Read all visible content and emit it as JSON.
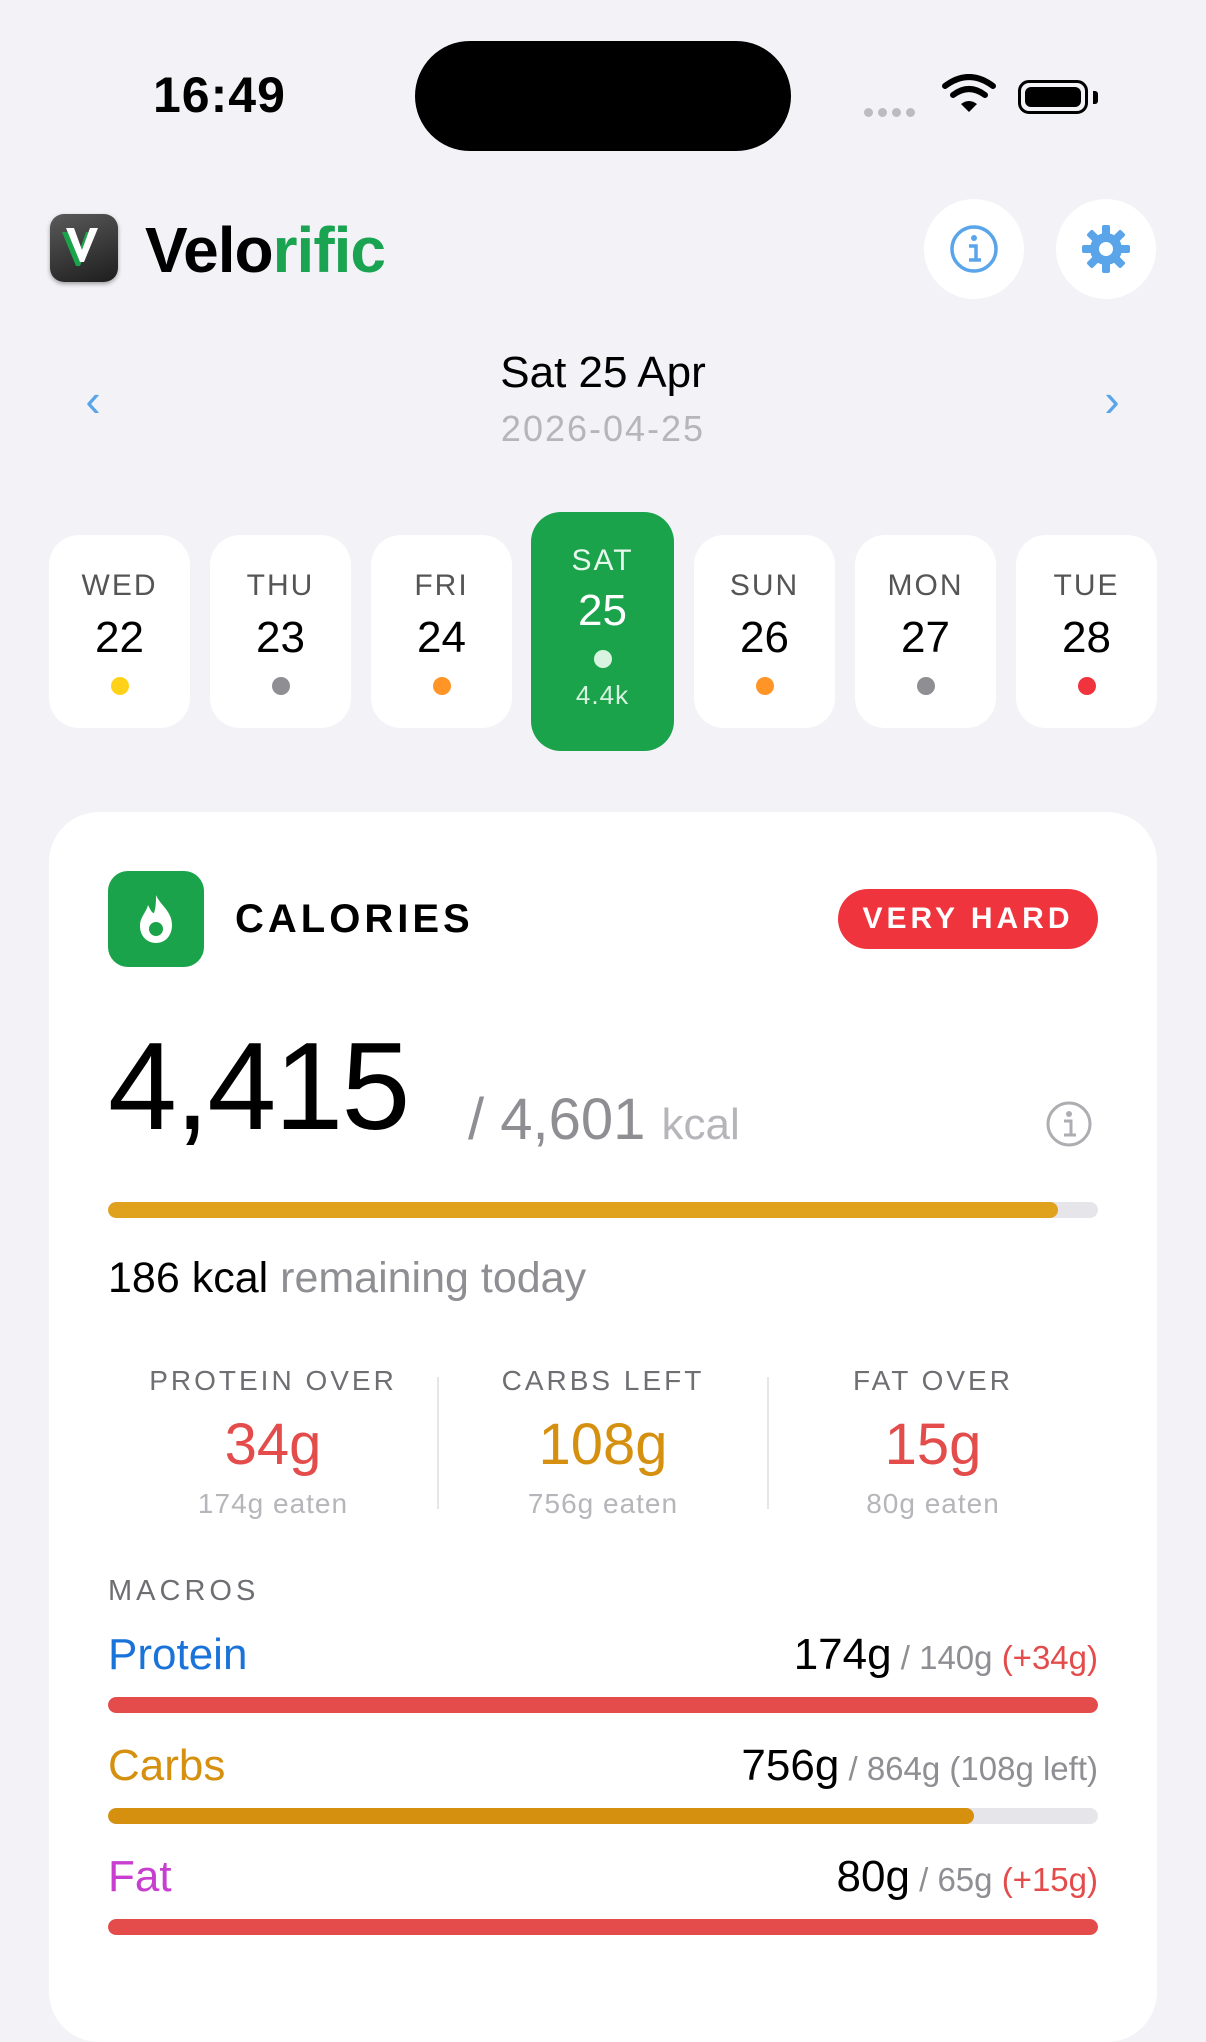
{
  "status": {
    "time": "16:49"
  },
  "app": {
    "name_dark": "Velo",
    "name_green": "rific"
  },
  "date": {
    "main": "Sat 25 Apr",
    "iso": "2026-04-25"
  },
  "days": [
    {
      "name": "WED",
      "num": "22",
      "dot": "#ffd21a"
    },
    {
      "name": "THU",
      "num": "23",
      "dot": "#8e8e93"
    },
    {
      "name": "FRI",
      "num": "24",
      "dot": "#ff9427"
    },
    {
      "name": "SAT",
      "num": "25",
      "dot": "#d9f3e1",
      "sub": "4.4k",
      "selected": true
    },
    {
      "name": "SUN",
      "num": "26",
      "dot": "#ff9427"
    },
    {
      "name": "MON",
      "num": "27",
      "dot": "#8e8e93"
    },
    {
      "name": "TUE",
      "num": "28",
      "dot": "#f0343e"
    }
  ],
  "card": {
    "label": "CALORIES",
    "badge": "VERY HARD",
    "consumed": "4,415",
    "goal": "/ 4,601",
    "unit": "kcal",
    "progress": 0.96,
    "remaining_value": "186 kcal",
    "remaining_text": "remaining today",
    "stats": [
      {
        "label": "PROTEIN OVER",
        "value": "34g",
        "sub": "174g eaten",
        "color": "#e44c4c"
      },
      {
        "label": "CARBS LEFT",
        "value": "108g",
        "sub": "756g eaten",
        "color": "#d6900f"
      },
      {
        "label": "FAT OVER",
        "value": "15g",
        "sub": "80g eaten",
        "color": "#e44c4c"
      }
    ],
    "macros_heading": "MACROS",
    "macros": [
      {
        "name": "Protein",
        "name_color": "#1a73d9",
        "value": "174g",
        "goal": "/ 140g",
        "delta": "(+34g)",
        "delta_color": "#e44c4c",
        "bar_color": "#e44c4c",
        "progress": 1.0
      },
      {
        "name": "Carbs",
        "name_color": "#d6900f",
        "value": "756g",
        "goal": "/ 864g",
        "delta": "(108g left)",
        "delta_color": "#8e8e93",
        "bar_color": "#d6900f",
        "progress": 0.875
      },
      {
        "name": "Fat",
        "name_color": "#c83fcf",
        "value": "80g",
        "goal": "/ 65g",
        "delta": "(+15g)",
        "delta_color": "#e44c4c",
        "bar_color": "#e44c4c",
        "progress": 1.0
      }
    ]
  },
  "colors": {
    "accent_green": "#1aa34a",
    "link_blue": "#5aa5ea",
    "calorie_bar": "#e0a21c"
  }
}
